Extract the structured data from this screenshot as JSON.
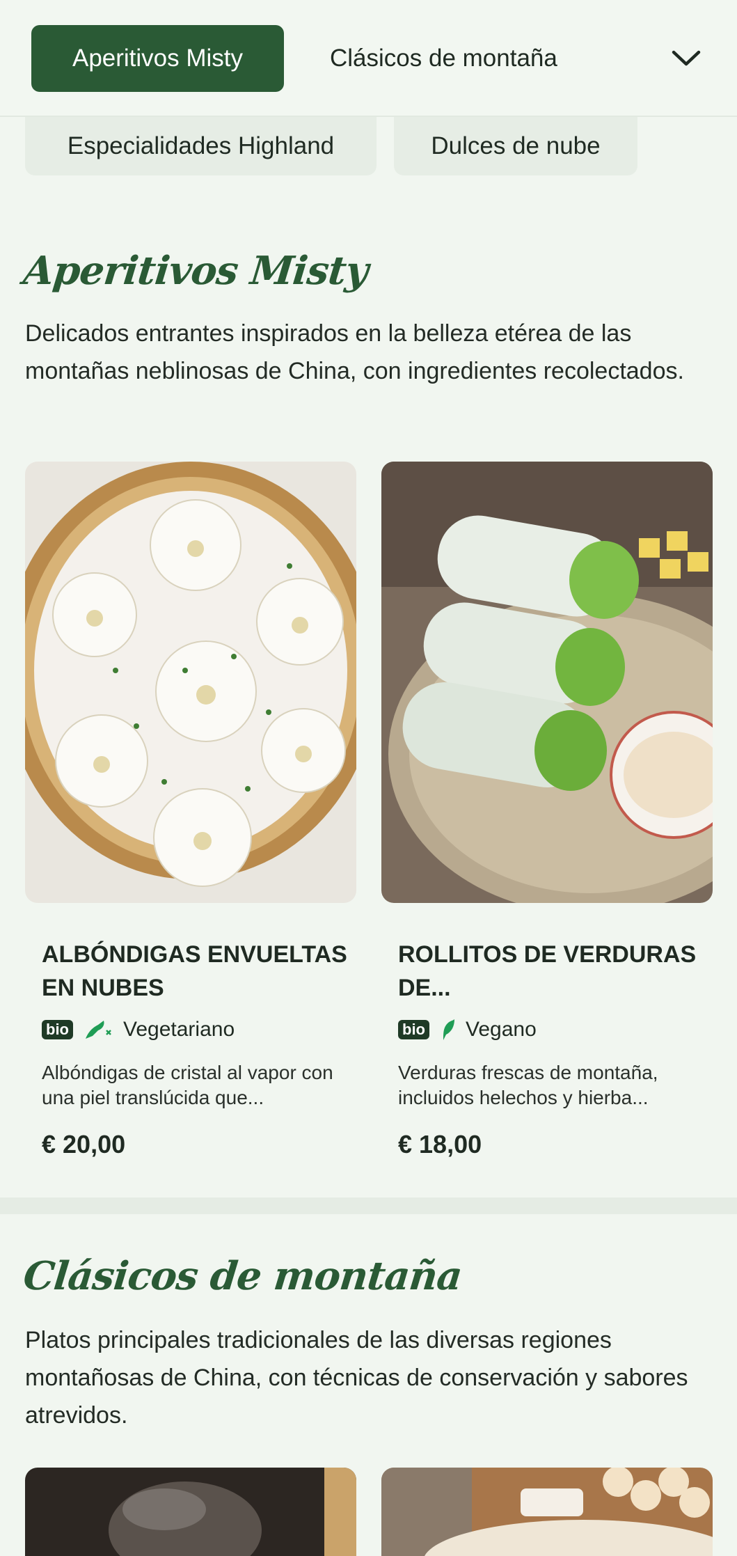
{
  "nav": {
    "tabs": [
      "Aperitivos Misty",
      "Clásicos de montaña",
      "Especialidades Highland",
      "Dulces de nube"
    ],
    "more_icon": "chevron-down-icon"
  },
  "sections": [
    {
      "title": "Aperitivos Misty",
      "description": "Delicados entrantes inspirados en la belleza etérea de las montañas neblinosas de China, con ingredientes recolectados.",
      "items": [
        {
          "name": "ALBÓNDIGAS ENVUELTAS EN NUBES",
          "badge": "bio",
          "diet": "Vegetariano",
          "diet_icon": "vegetarian-icon",
          "description": "Albóndigas de cristal al vapor con una piel translúcida que...",
          "price": "€ 20,00"
        },
        {
          "name": "ROLLITOS DE VERDURAS DE...",
          "badge": "bio",
          "diet": "Vegano",
          "diet_icon": "leaf-icon",
          "description": "Verduras frescas de montaña, incluidos helechos y hierba...",
          "price": "€ 18,00"
        }
      ]
    },
    {
      "title": "Clásicos de montaña",
      "description": "Platos principales tradicionales de las diversas regiones montañosas de China, con técnicas de conservación y sabores atrevidos."
    }
  ],
  "colors": {
    "accent": "#2a5a35",
    "background": "#f1f6f0",
    "pill": "#e6ede5",
    "diet_icon": "#1f9d55"
  }
}
